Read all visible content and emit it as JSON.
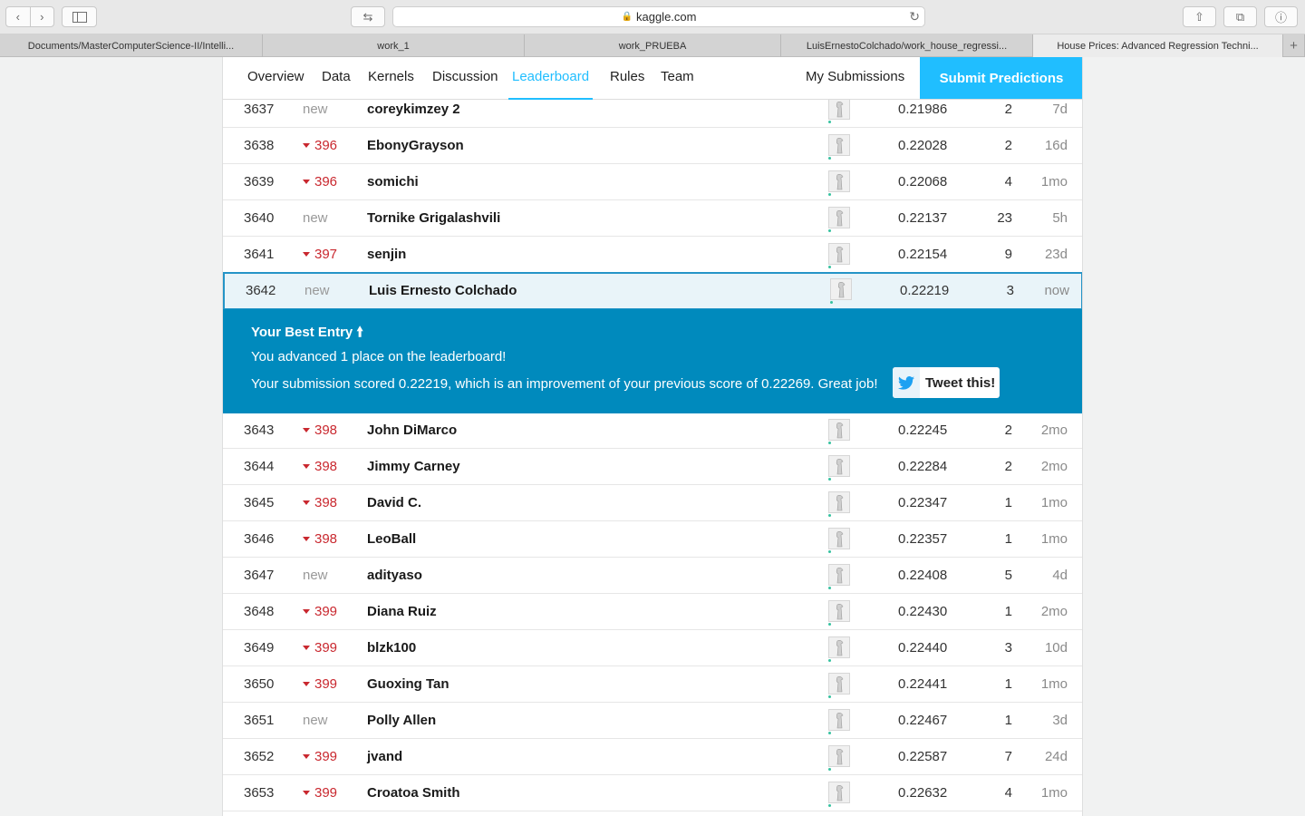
{
  "browser": {
    "url": "kaggle.com",
    "tabs": [
      {
        "label": "Documents/MasterComputerScience-II/Intelli...",
        "active": false
      },
      {
        "label": "work_1",
        "active": false
      },
      {
        "label": "work_PRUEBA",
        "active": false
      },
      {
        "label": "LuisErnestoColchado/work_house_regressi...",
        "active": false
      },
      {
        "label": "House Prices: Advanced Regression Techni...",
        "active": true
      }
    ]
  },
  "nav": {
    "items": [
      "Overview",
      "Data",
      "Kernels",
      "Discussion",
      "Leaderboard",
      "Rules",
      "Team"
    ],
    "active": "Leaderboard",
    "my_submissions": "My Submissions",
    "submit": "Submit Predictions"
  },
  "rows_before": [
    {
      "rank": "3637",
      "change": "new",
      "down": false,
      "name": "coreykimzey 2",
      "score": "0.21986",
      "entries": "2",
      "last": "7d"
    },
    {
      "rank": "3638",
      "change": "396",
      "down": true,
      "name": "EbonyGrayson",
      "score": "0.22028",
      "entries": "2",
      "last": "16d"
    },
    {
      "rank": "3639",
      "change": "396",
      "down": true,
      "name": "somichi",
      "score": "0.22068",
      "entries": "4",
      "last": "1mo"
    },
    {
      "rank": "3640",
      "change": "new",
      "down": false,
      "name": "Tornike Grigalashvili",
      "score": "0.22137",
      "entries": "23",
      "last": "5h"
    },
    {
      "rank": "3641",
      "change": "397",
      "down": true,
      "name": "senjin",
      "score": "0.22154",
      "entries": "9",
      "last": "23d"
    }
  ],
  "my_row": {
    "rank": "3642",
    "change": "new",
    "down": false,
    "name": "Luis Ernesto Colchado",
    "score": "0.22219",
    "entries": "3",
    "last": "now"
  },
  "best_entry": {
    "title": "Your Best Entry",
    "advanced": "You advanced 1 place on the leaderboard!",
    "scored": "Your submission scored 0.22219, which is an improvement of your previous score of 0.22269. Great job!",
    "tweet": "Tweet this!"
  },
  "rows_after": [
    {
      "rank": "3643",
      "change": "398",
      "down": true,
      "name": "John DiMarco",
      "score": "0.22245",
      "entries": "2",
      "last": "2mo"
    },
    {
      "rank": "3644",
      "change": "398",
      "down": true,
      "name": "Jimmy Carney",
      "score": "0.22284",
      "entries": "2",
      "last": "2mo"
    },
    {
      "rank": "3645",
      "change": "398",
      "down": true,
      "name": "David C.",
      "score": "0.22347",
      "entries": "1",
      "last": "1mo"
    },
    {
      "rank": "3646",
      "change": "398",
      "down": true,
      "name": "LeoBall",
      "score": "0.22357",
      "entries": "1",
      "last": "1mo"
    },
    {
      "rank": "3647",
      "change": "new",
      "down": false,
      "name": "adityaso",
      "score": "0.22408",
      "entries": "5",
      "last": "4d"
    },
    {
      "rank": "3648",
      "change": "399",
      "down": true,
      "name": "Diana Ruiz",
      "score": "0.22430",
      "entries": "1",
      "last": "2mo"
    },
    {
      "rank": "3649",
      "change": "399",
      "down": true,
      "name": "blzk100",
      "score": "0.22440",
      "entries": "3",
      "last": "10d"
    },
    {
      "rank": "3650",
      "change": "399",
      "down": true,
      "name": "Guoxing Tan",
      "score": "0.22441",
      "entries": "1",
      "last": "1mo"
    },
    {
      "rank": "3651",
      "change": "new",
      "down": false,
      "name": "Polly Allen",
      "score": "0.22467",
      "entries": "1",
      "last": "3d"
    },
    {
      "rank": "3652",
      "change": "399",
      "down": true,
      "name": "jvand",
      "score": "0.22587",
      "entries": "7",
      "last": "24d"
    },
    {
      "rank": "3653",
      "change": "399",
      "down": true,
      "name": "Croatoa Smith",
      "score": "0.22632",
      "entries": "4",
      "last": "1mo"
    }
  ]
}
